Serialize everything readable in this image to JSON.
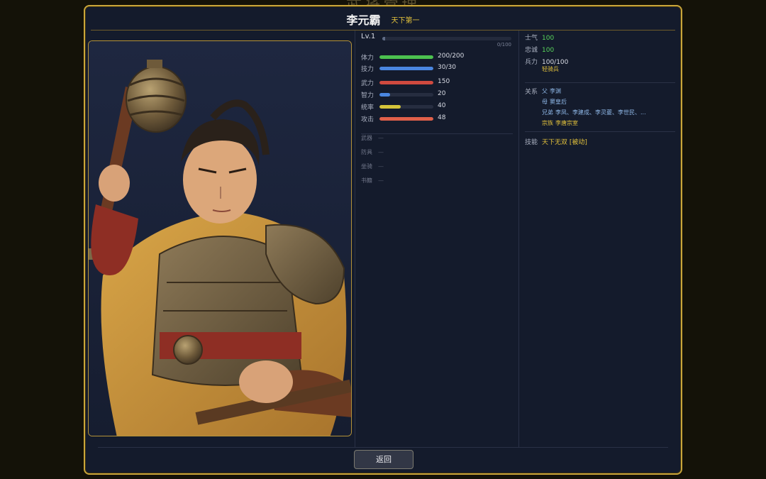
{
  "background_title": "武将管理",
  "hero": {
    "name": "李元霸",
    "title": "天下第一"
  },
  "level": {
    "label": "Lv.1",
    "exp_text": "0/100",
    "exp_fraction": 0.02
  },
  "stats": [
    {
      "label": "体力",
      "value": "200/200",
      "fraction": 1.0,
      "color": "#4cc24f"
    },
    {
      "label": "技力",
      "value": "30/30",
      "fraction": 1.0,
      "color": "#4a86e0"
    },
    {
      "label": "武力",
      "value": "150",
      "fraction": 1.0,
      "color": "#cf4a3f"
    },
    {
      "label": "智力",
      "value": "20",
      "fraction": 0.2,
      "color": "#4a86e0"
    },
    {
      "label": "统率",
      "value": "40",
      "fraction": 0.4,
      "color": "#d4c43a"
    },
    {
      "label": "攻击",
      "value": "48",
      "fraction": 1.0,
      "color": "#e0604a"
    }
  ],
  "equipment": [
    {
      "label": "武器",
      "value": "—"
    },
    {
      "label": "防具",
      "value": "—"
    },
    {
      "label": "坐骑",
      "value": "—"
    },
    {
      "label": "书籍",
      "value": "—"
    }
  ],
  "status": {
    "morale": {
      "label": "士气",
      "value": "100"
    },
    "loyalty": {
      "label": "忠诚",
      "value": "100"
    },
    "troops": {
      "label": "兵力",
      "value": "100/100",
      "type": "轻骑兵"
    }
  },
  "relations": {
    "label": "关系",
    "items": [
      {
        "kind": "父",
        "names": "李渊"
      },
      {
        "kind": "母",
        "names": "窦皇后"
      },
      {
        "kind": "兄弟",
        "names": "李凤、李建成、李灵夔、李世民、..."
      },
      {
        "kind": "宗族",
        "names": "李唐宗室"
      }
    ]
  },
  "skill": {
    "label": "技能",
    "value": "天下无双 [被动]"
  },
  "footer": {
    "back_label": "返回"
  },
  "colors": {
    "frame_gold": "#c9a53a",
    "panel_bg": "#141b2c",
    "accent_yellow": "#e2c13c",
    "accent_green": "#57d45b"
  }
}
